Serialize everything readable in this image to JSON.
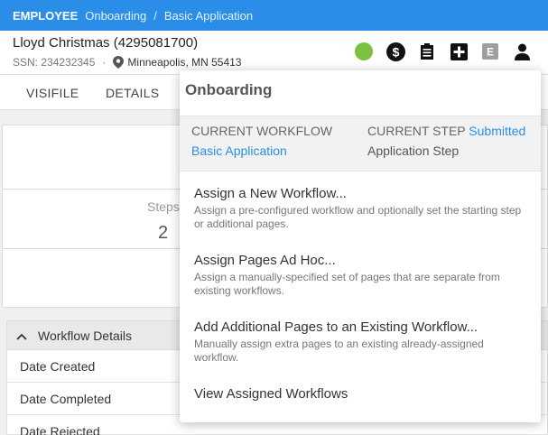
{
  "breadcrumb": {
    "root": "EMPLOYEE",
    "items": [
      "Onboarding",
      "Basic Application"
    ],
    "separator": "/"
  },
  "employee": {
    "name": "Lloyd Christmas (4295081700)",
    "ssn": "SSN: 234232345",
    "separator": "·",
    "location": "Minneapolis, MN 55413"
  },
  "header_icons": [
    "status-online",
    "dollar-icon",
    "clipboard-icon",
    "add-icon",
    "e-badge-icon",
    "person-icon"
  ],
  "tabs": [
    "VISIFILE",
    "DETAILS"
  ],
  "summary": {
    "steps_label": "Steps",
    "steps_value": "2"
  },
  "workflow_details": {
    "title": "Workflow Details",
    "rows": [
      "Date Created",
      "Date Completed",
      "Date Rejected"
    ]
  },
  "popup": {
    "title": "Onboarding",
    "current_workflow_label": "CURRENT WORKFLOW",
    "current_workflow_value": "Basic Application",
    "current_step_label": "CURRENT STEP",
    "current_step_status": "Submitted",
    "current_step_value": "Application Step",
    "options": [
      {
        "title": "Assign a New Workflow...",
        "desc": "Assign a pre-configured workflow and optionally set the starting step or additional pages."
      },
      {
        "title": "Assign Pages Ad Hoc...",
        "desc": "Assign a manually-specified set of pages that are separate from existing workflows."
      },
      {
        "title": "Add Additional Pages to an Existing Workflow...",
        "desc": "Manually assign extra pages to an existing already-assigned workflow."
      },
      {
        "title": "View Assigned Workflows",
        "desc": ""
      }
    ]
  },
  "colors": {
    "primary": "#2a8ee8",
    "status_green": "#7dc143",
    "panel_bg": "#f0f0f0"
  }
}
